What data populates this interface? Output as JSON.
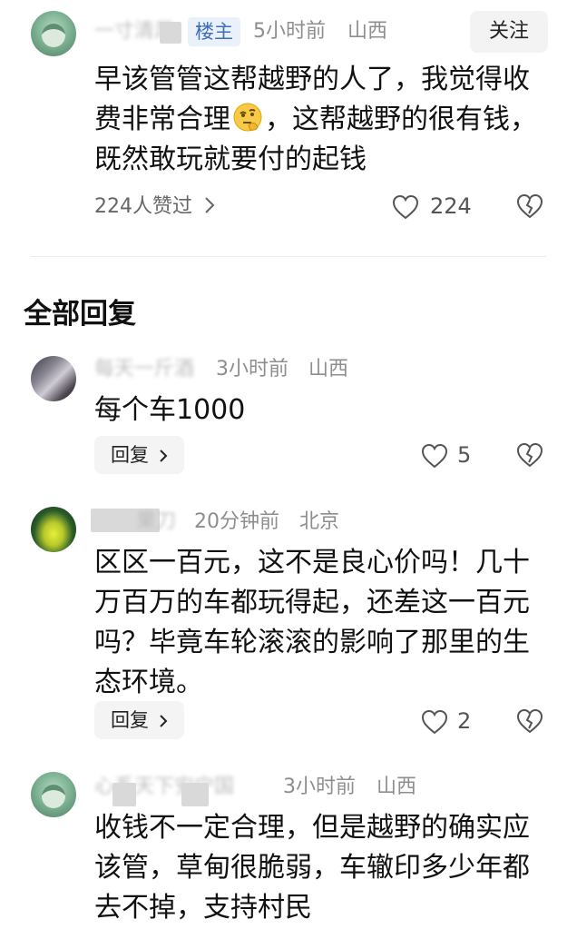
{
  "main_comment": {
    "user_name": "一寸清风",
    "badge": "楼主",
    "time": "5小时前",
    "location": "山西",
    "follow_label": "关注",
    "content": "早该管管这帮越野的人了，我觉得收费非常合理",
    "content_tail": "，这帮越野的很有钱，既然敢玩就要付的起钱",
    "liked_text": "224人赞过",
    "like_count": "224",
    "emoji_icon": "thinking-face-icon"
  },
  "replies_section": {
    "title": "全部回复"
  },
  "replies": [
    {
      "user_name": "每天一斤酒",
      "time": "3小时前",
      "location": "山西",
      "content": "每个车1000",
      "reply_label": "回复",
      "like_count": "5"
    },
    {
      "user_name": "果刀",
      "time": "20分钟前",
      "location": "北京",
      "content": "区区一百元，这不是良心价吗！几十万百万的车都玩得起，还差这一百元吗？毕竟车轮滚滚的影响了那里的生态环境。",
      "reply_label": "回复",
      "like_count": "2"
    },
    {
      "user_name": "心系天下安宁国",
      "time": "3小时前",
      "location": "山西",
      "content": "收钱不一定合理，但是越野的确实应该管，草甸很脆弱，车辙印多少年都去不掉，支持村民"
    }
  ],
  "colors": {
    "badge_text": "#3f6fb8",
    "badge_bg": "#eaf1fb",
    "meta_text": "#8e8e8e"
  },
  "icons": {
    "like": "heart-outline-icon",
    "dislike": "broken-heart-icon",
    "chevron": "chevron-right-icon"
  }
}
